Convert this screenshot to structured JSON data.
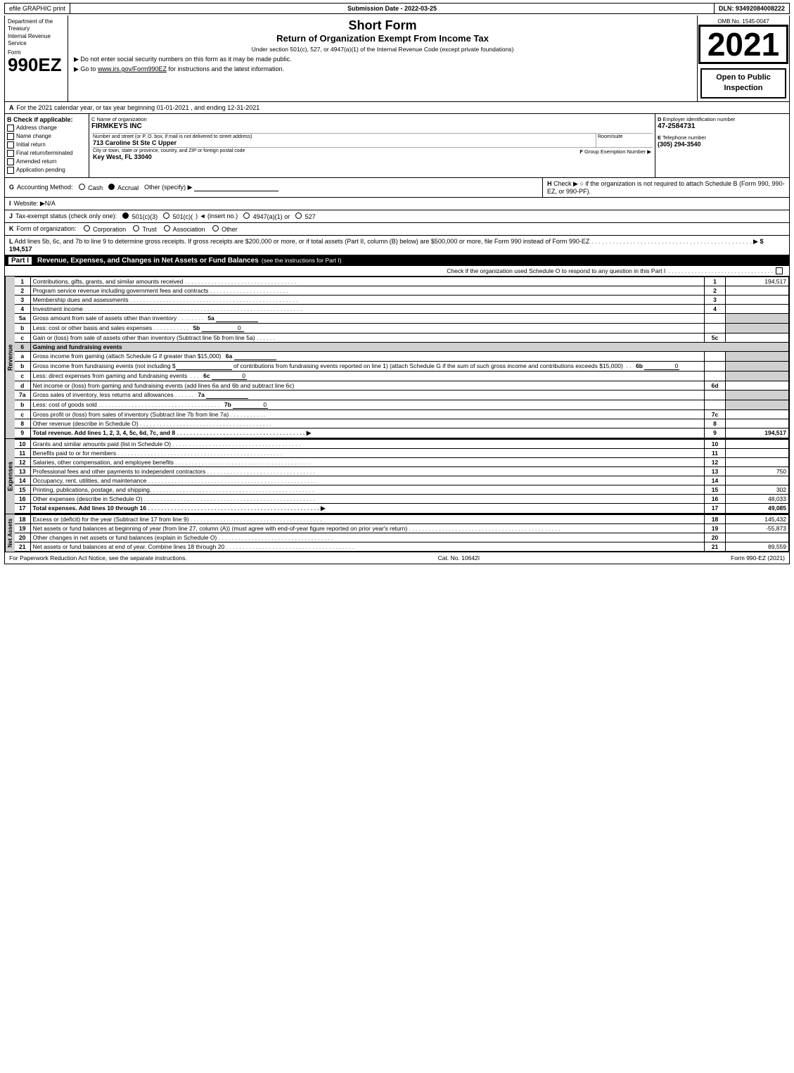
{
  "topBar": {
    "efile": "efile GRAPHIC print",
    "submission": "Submission Date - 2022-03-25",
    "dln": "DLN: 93492084008222"
  },
  "header": {
    "omb": "OMB No. 1545-0047",
    "formNumber": "990EZ",
    "shortForm": "Short Form",
    "returnTitle": "Return of Organization Exempt From Income Tax",
    "subtitle": "Under section 501(c), 527, or 4947(a)(1) of the Internal Revenue Code (except private foundations)",
    "bullet1": "▶ Do not enter social security numbers on this form as it may be made public.",
    "bullet2": "▶ Go to www.irs.gov/Form990EZ for instructions and the latest information.",
    "year": "2021",
    "deptLine1": "Department of the",
    "deptLine2": "Treasury",
    "deptLine3": "Internal Revenue",
    "deptLine4": "Service",
    "openPublic": "Open to Public Inspection"
  },
  "sectionA": {
    "label": "A",
    "text": "For the 2021 calendar year, or tax year beginning 01-01-2021 , and ending 12-31-2021"
  },
  "sectionB": {
    "label": "B",
    "labelText": "Check if applicable:",
    "items": [
      {
        "id": "address-change",
        "label": "Address change",
        "checked": false
      },
      {
        "id": "name-change",
        "label": "Name change",
        "checked": false
      },
      {
        "id": "initial-return",
        "label": "Initial return",
        "checked": false
      },
      {
        "id": "final-return",
        "label": "Final return/terminated",
        "checked": false
      },
      {
        "id": "amended-return",
        "label": "Amended return",
        "checked": false
      },
      {
        "id": "application-pending",
        "label": "Application pending",
        "checked": false
      }
    ]
  },
  "sectionC": {
    "label": "C",
    "labelText": "Name of organization",
    "orgName": "FIRMKEYS INC"
  },
  "sectionD": {
    "label": "D",
    "labelText": "Employer identification number",
    "ein": "47-2584731"
  },
  "address": {
    "label": "Number and street (or P. O. box, if mail is not delivered to street address)",
    "value": "713 Caroline St Ste C Upper",
    "roomLabel": "Room/suite",
    "roomValue": ""
  },
  "sectionE": {
    "label": "E",
    "labelText": "Telephone number",
    "phone": "(305) 294-3540"
  },
  "cityState": {
    "label": "City or town, state or province, country, and ZIP or foreign postal code",
    "value": "Key West, FL 33040"
  },
  "sectionF": {
    "label": "F",
    "labelText": "Group Exemption Number",
    "arrow": "▶"
  },
  "sectionG": {
    "label": "G",
    "text": "Accounting Method:",
    "cashLabel": "Cash",
    "accrualLabel": "Accrual",
    "accrualChecked": true,
    "otherLabel": "Other (specify) ▶"
  },
  "sectionH": {
    "label": "H",
    "text": "Check ▶",
    "description": "○ if the organization is not required to attach Schedule B (Form 990, 990-EZ, or 990-PF)."
  },
  "sectionI": {
    "label": "I",
    "text": "Website: ▶N/A"
  },
  "sectionJ": {
    "label": "J",
    "text": "Tax-exempt status (check only one):",
    "options": [
      {
        "label": "501(c)(3)",
        "checked": true
      },
      {
        "label": "501(c)(",
        "checked": false
      },
      {
        "label": ") ◄ (insert no.)",
        "checked": false
      },
      {
        "label": "4947(a)(1) or",
        "checked": false
      },
      {
        "label": "527",
        "checked": false
      }
    ]
  },
  "sectionK": {
    "label": "K",
    "text": "Form of organization:",
    "options": [
      "Corporation",
      "Trust",
      "Association",
      "Other"
    ]
  },
  "sectionL": {
    "label": "L",
    "text": "Add lines 5b, 6c, and 7b to line 9 to determine gross receipts. If gross receipts are $200,000 or more, or if total assets (Part II, column (B) below) are $500,000 or more, file Form 990 instead of Form 990-EZ",
    "dots": ". . . . . . . . . . . . . . . . . . . . . . . . . . . . . . . . . . . . . . . . . . . . . .",
    "arrow": "▶",
    "amount": "$ 194,517"
  },
  "partI": {
    "label": "Part I",
    "title": "Revenue, Expenses, and Changes in Net Assets or Fund Balances",
    "seeNote": "(see the instructions for Part I)",
    "checkNote": "Check if the organization used Schedule O to respond to any question in this Part I",
    "checkDots": ". . . . . . . . . . . . . . . . . . . . . . . . . . . . . . . .",
    "rows": [
      {
        "num": "1",
        "desc": "Contributions, gifts, grants, and similar amounts received",
        "dots": ". . . . . . . . . . . . . . . . . . . . . . . . . . . . . . . . . .",
        "lineRef": "1",
        "amount": "194,517",
        "shaded": false
      },
      {
        "num": "2",
        "desc": "Program service revenue including government fees and contracts",
        "dots": ". . . . . . . . . . . . . . . . . . . . . . .",
        "lineRef": "2",
        "amount": "",
        "shaded": false
      },
      {
        "num": "3",
        "desc": "Membership dues and assessments",
        "dots": ". . . . . . . . . . . . . . . . . . . . . . . . . . . . . . . . . . . . . . . . . . . . . . . . . . .",
        "lineRef": "3",
        "amount": "",
        "shaded": false
      },
      {
        "num": "4",
        "desc": "Investment income",
        "dots": ". . . . . . . . . . . . . . . . . . . . . . . . . . . . . . . . . . . . . . . . . . . . . . . . . . . . . . . . . . . . . . . . . .",
        "lineRef": "4",
        "amount": "",
        "shaded": false
      },
      {
        "num": "5a",
        "desc": "Gross amount from sale of assets other than inventory",
        "dots": ". . . . . . . .",
        "subRef": "5a",
        "subAmount": "",
        "lineRef": "",
        "amount": "",
        "hasSub": true,
        "shaded": false
      },
      {
        "num": "b",
        "desc": "Less: cost or other basis and sales expenses",
        "dots": ". . . . . . . . . . .",
        "subRef": "5b",
        "subAmount": "0",
        "lineRef": "",
        "amount": "",
        "hasSub": true,
        "shaded": false
      },
      {
        "num": "c",
        "desc": "Gain or (loss) from sale of assets other than inventory (Subtract line 5b from line 5a)",
        "dots": ". . . . . .",
        "lineRef": "5c",
        "amount": "",
        "hasSub": false,
        "shaded": false
      },
      {
        "num": "6",
        "desc": "Gaming and fundraising events",
        "lineRef": "",
        "amount": "",
        "shaded": true,
        "noAmount": true
      }
    ]
  },
  "gamingRows": [
    {
      "num": "a",
      "desc": "Gross income from gaming (attach Schedule G if greater than $15,000)",
      "dots": "",
      "subRef": "6a",
      "subAmount": "",
      "lineRef": "",
      "amount": ""
    },
    {
      "num": "b",
      "desc": "Gross income from fundraising events (not including $",
      "blank": "______________",
      "desc2": "of contributions from fundraising events reported on line 1) (attach Schedule G if the sum of such gross income and contributions exceeds $15,000)",
      "dots": "  .  .",
      "subRef": "6b",
      "subAmount": "0",
      "lineRef": "",
      "amount": ""
    },
    {
      "num": "c",
      "desc": "Less: direct expenses from gaming and fundraising events",
      "dots": "  .  .  .",
      "subRef": "6c",
      "subAmount": "0",
      "lineRef": "",
      "amount": ""
    },
    {
      "num": "d",
      "desc": "Net income or (loss) from gaming and fundraising events (add lines 6a and 6b and subtract line 6c)",
      "dots": "",
      "subRef": "",
      "subAmount": "",
      "lineRef": "6d",
      "amount": ""
    }
  ],
  "inventoryRows": [
    {
      "num": "7a",
      "desc": "Gross sales of inventory, less returns and allowances",
      "dots": ". . . . . .",
      "subRef": "7a",
      "subAmount": ""
    },
    {
      "num": "b",
      "desc": "Less: cost of goods sold",
      "dots": ". . . . . . . . . . . . . . . . . . . . . . . . . . . . . . . . . . . . .",
      "subRef": "7b",
      "subAmount": "0"
    },
    {
      "num": "c",
      "desc": "Gross profit or (loss) from sales of inventory (Subtract line 7b from line 7a)",
      "dots": ". . . . . . . . . . .",
      "lineRef": "7c",
      "amount": ""
    },
    {
      "num": "8",
      "desc": "Other revenue (describe in Schedule O)",
      "dots": ". . . . . . . . . . . . . . . . . . . . . . . . . . . . . . . . . . . . . . . . .",
      "lineRef": "8",
      "amount": ""
    },
    {
      "num": "9",
      "desc": "Total revenue. Add lines 1, 2, 3, 4, 5c, 6d, 7c, and 8",
      "dots": ". . . . . . . . . . . . . . . . . . . . . . . . . . . . . . . . . . . . . . .",
      "arrow": "▶",
      "lineRef": "9",
      "amount": "194,517",
      "bold": true
    }
  ],
  "expenseRows": [
    {
      "num": "10",
      "desc": "Grants and similar amounts paid (list in Schedule O)",
      "dots": ". . . . . . . . . . . . . . . . . . . . . . . . . . . . . . . . . . . . . . .",
      "lineRef": "10",
      "amount": ""
    },
    {
      "num": "11",
      "desc": "Benefits paid to or for members",
      "dots": ". . . . . . . . . . . . . . . . . . . . . . . . . . . . . . . . . . . . . . . . . . . . . . . . . .",
      "lineRef": "11",
      "amount": ""
    },
    {
      "num": "12",
      "desc": "Salaries, other compensation, and employee benefits",
      "dots": ". . . . . . . . . . . . . . . . . . . . . . . . . . . . . . . . . . . . . . . . .",
      "lineRef": "12",
      "amount": ""
    },
    {
      "num": "13",
      "desc": "Professional fees and other payments to independent contractors",
      "dots": ". . . . . . . . . . . . . . . . . . . . . . . . . . . . . . . . .",
      "lineRef": "13",
      "amount": "750"
    },
    {
      "num": "14",
      "desc": "Occupancy, rent, utilities, and maintenance",
      "dots": ". . . . . . . . . . . . . . . . . . . . . . . . . . . . . . . . . . . . . . . . . . . . . . . . . . .",
      "lineRef": "14",
      "amount": ""
    },
    {
      "num": "15",
      "desc": "Printing, publications, postage, and shipping.",
      "dots": ". . . . . . . . . . . . . . . . . . . . . . . . . . . . . . . . . . . . . . . . . . . . . . . . .",
      "lineRef": "15",
      "amount": "302"
    },
    {
      "num": "16",
      "desc": "Other expenses (describe in Schedule O)",
      "dots": ". . . . . . . . . . . . . . . . . . . . . . . . . . . . . . . . . . . . . . . . . . . . . . . . . . . .",
      "lineRef": "16",
      "amount": "48,033"
    },
    {
      "num": "17",
      "desc": "Total expenses. Add lines 10 through 16",
      "dots": ". . . . . . . . . . . . . . . . . . . . . . . . . . . . . . . . . . . . . . . . . . . . . . . . . . . .",
      "arrow": "▶",
      "lineRef": "17",
      "amount": "49,085",
      "bold": true
    }
  ],
  "netAssetRows": [
    {
      "num": "18",
      "desc": "Excess or (deficit) for the year (Subtract line 17 from line 9)",
      "dots": ". . . . . . . . . . . . . . . . . . . . . . . . . . . . . . . . . . . . . . . .",
      "lineRef": "18",
      "amount": "145,432"
    },
    {
      "num": "19",
      "desc": "Net assets or fund balances at beginning of year (from line 27, column (A)) (must agree with end-of-year figure reported on prior year's return)",
      "dots": ". . . . . . . . . . . . . . . . . . . . . . . . . . . . . . . . . . . . . . . . . . . . . .",
      "lineRef": "19",
      "amount": "-55,873"
    },
    {
      "num": "20",
      "desc": "Other changes in net assets or fund balances (explain in Schedule O)",
      "dots": ". . . . . . . . . . . . . . . . . . . . . . . . . . . . . . . . . . . .",
      "lineRef": "20",
      "amount": ""
    },
    {
      "num": "21",
      "desc": "Net assets or fund balances at end of year. Combine lines 18 through 20",
      "dots": ". . . . . . . . . . . . . . . . . . . . . . . . . . . . . . . . . . . . . . .",
      "lineRef": "21",
      "amount": "89,559"
    }
  ],
  "footer": {
    "paperwork": "For Paperwork Reduction Act Notice, see the separate instructions.",
    "catNo": "Cat. No. 10642I",
    "formRef": "Form 990-EZ (2021)"
  }
}
